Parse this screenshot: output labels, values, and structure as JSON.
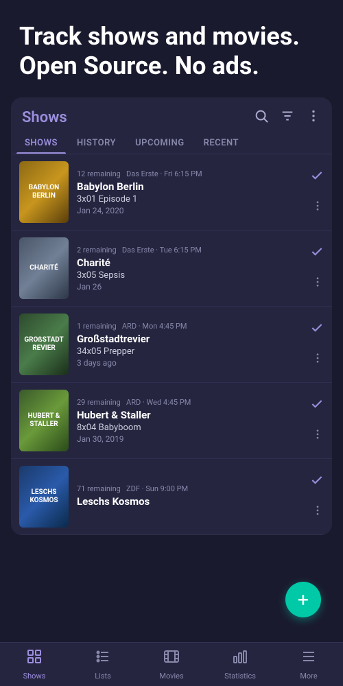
{
  "hero": {
    "title": "Track shows and movies. Open Source. No ads."
  },
  "card": {
    "title": "Shows",
    "tabs": [
      {
        "label": "SHOWS",
        "active": true
      },
      {
        "label": "HISTORY",
        "active": false
      },
      {
        "label": "UPCOMING",
        "active": false
      },
      {
        "label": "RECENT",
        "active": false
      }
    ]
  },
  "shows": [
    {
      "remaining": "12 remaining",
      "channel": "Das Erste",
      "time": "Fri 6:15 PM",
      "name": "Babylon Berlin",
      "episode": "3x01 Episode 1",
      "date": "Jan 24, 2020",
      "poster_label": "BABYLON BERLIN",
      "poster_class": "poster-babylon"
    },
    {
      "remaining": "2 remaining",
      "channel": "Das Erste",
      "time": "Tue 6:15 PM",
      "name": "Charité",
      "episode": "3x05 Sepsis",
      "date": "Jan 26",
      "poster_label": "CHARITÉ",
      "poster_class": "poster-charite"
    },
    {
      "remaining": "1 remaining",
      "channel": "ARD",
      "time": "Mon 4:45 PM",
      "name": "Großstadtrevier",
      "episode": "34x05 Prepper",
      "date": "3 days ago",
      "poster_label": "GROßSTADT REVIER",
      "poster_class": "poster-grossstadt"
    },
    {
      "remaining": "29 remaining",
      "channel": "ARD",
      "time": "Wed 4:45 PM",
      "name": "Hubert & Staller",
      "episode": "8x04 Babyboom",
      "date": "Jan 30, 2019",
      "poster_label": "HUBERT & STALLER",
      "poster_class": "poster-hubert"
    },
    {
      "remaining": "71 remaining",
      "channel": "ZDF",
      "time": "Sun 9:00 PM",
      "name": "Leschs Kosmos",
      "episode": "",
      "date": "",
      "poster_label": "LESCHS KOSMOS",
      "poster_class": "poster-leschs"
    }
  ],
  "fab": {
    "label": "+"
  },
  "bottom_nav": [
    {
      "label": "Shows",
      "active": true,
      "icon": "shows"
    },
    {
      "label": "Lists",
      "active": false,
      "icon": "lists"
    },
    {
      "label": "Movies",
      "active": false,
      "icon": "movies"
    },
    {
      "label": "Statistics",
      "active": false,
      "icon": "statistics"
    },
    {
      "label": "More",
      "active": false,
      "icon": "more"
    }
  ]
}
